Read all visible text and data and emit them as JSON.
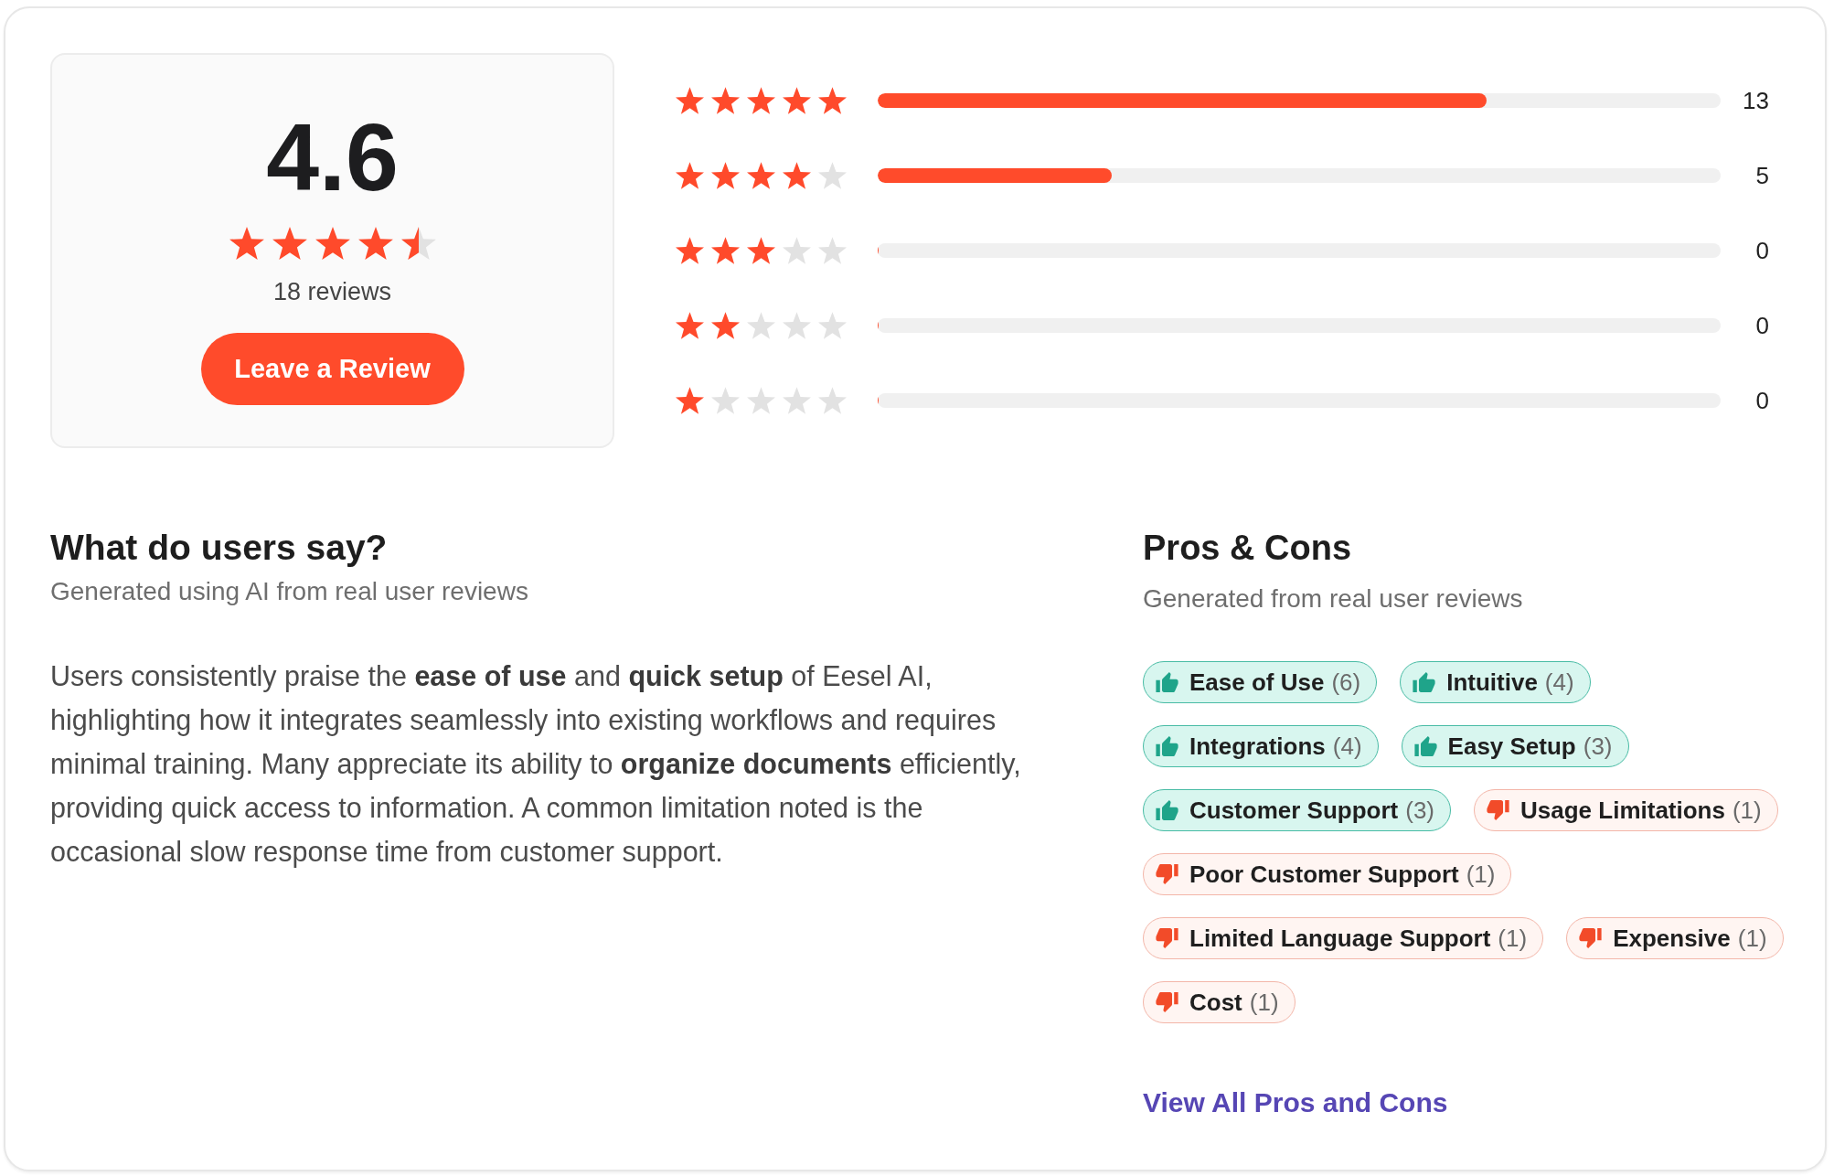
{
  "rating_summary": {
    "score": "4.6",
    "stars": 4.5,
    "review_count": "18 reviews",
    "button": "Leave a Review"
  },
  "breakdown": [
    {
      "stars": 5,
      "level": 0.722,
      "count": "13"
    },
    {
      "stars": 4,
      "level": 0.278,
      "count": "5"
    },
    {
      "stars": 3,
      "level": 0,
      "count": "0"
    },
    {
      "stars": 2,
      "level": 0,
      "count": "0"
    },
    {
      "stars": 1,
      "level": 0,
      "count": "0"
    }
  ],
  "summary": {
    "title": "What do users say?",
    "subtitle": "Generated using AI from real user reviews",
    "text": "Users consistently praise the **ease of use** and **quick setup** of Eesel AI, highlighting how it integrates seamlessly into existing workflows and requires minimal training. Many appreciate its ability to **organize documents** efficiently, providing quick access to information. A common limitation noted is the occasional slow response time from customer support."
  },
  "pros_cons": {
    "title": "Pros & Cons",
    "subtitle": "Generated from real user reviews",
    "tags": [
      {
        "kind": "pro",
        "label": "Ease of Use",
        "count": "(6)"
      },
      {
        "kind": "pro",
        "label": "Intuitive",
        "count": "(4)"
      },
      {
        "kind": "pro",
        "label": "Integrations",
        "count": "(4)"
      },
      {
        "kind": "pro",
        "label": "Easy Setup",
        "count": "(3)"
      },
      {
        "kind": "pro",
        "label": "Customer Support",
        "count": "(3)"
      },
      {
        "kind": "con",
        "label": "Usage Limitations",
        "count": "(1)"
      },
      {
        "kind": "con",
        "label": "Poor Customer Support",
        "count": "(1)"
      },
      {
        "kind": "con",
        "label": "Limited Language Support",
        "count": "(1)"
      },
      {
        "kind": "con",
        "label": "Expensive",
        "count": "(1)"
      },
      {
        "kind": "con",
        "label": "Cost",
        "count": "(1)"
      }
    ],
    "link": "View All Pros and Cons"
  }
}
